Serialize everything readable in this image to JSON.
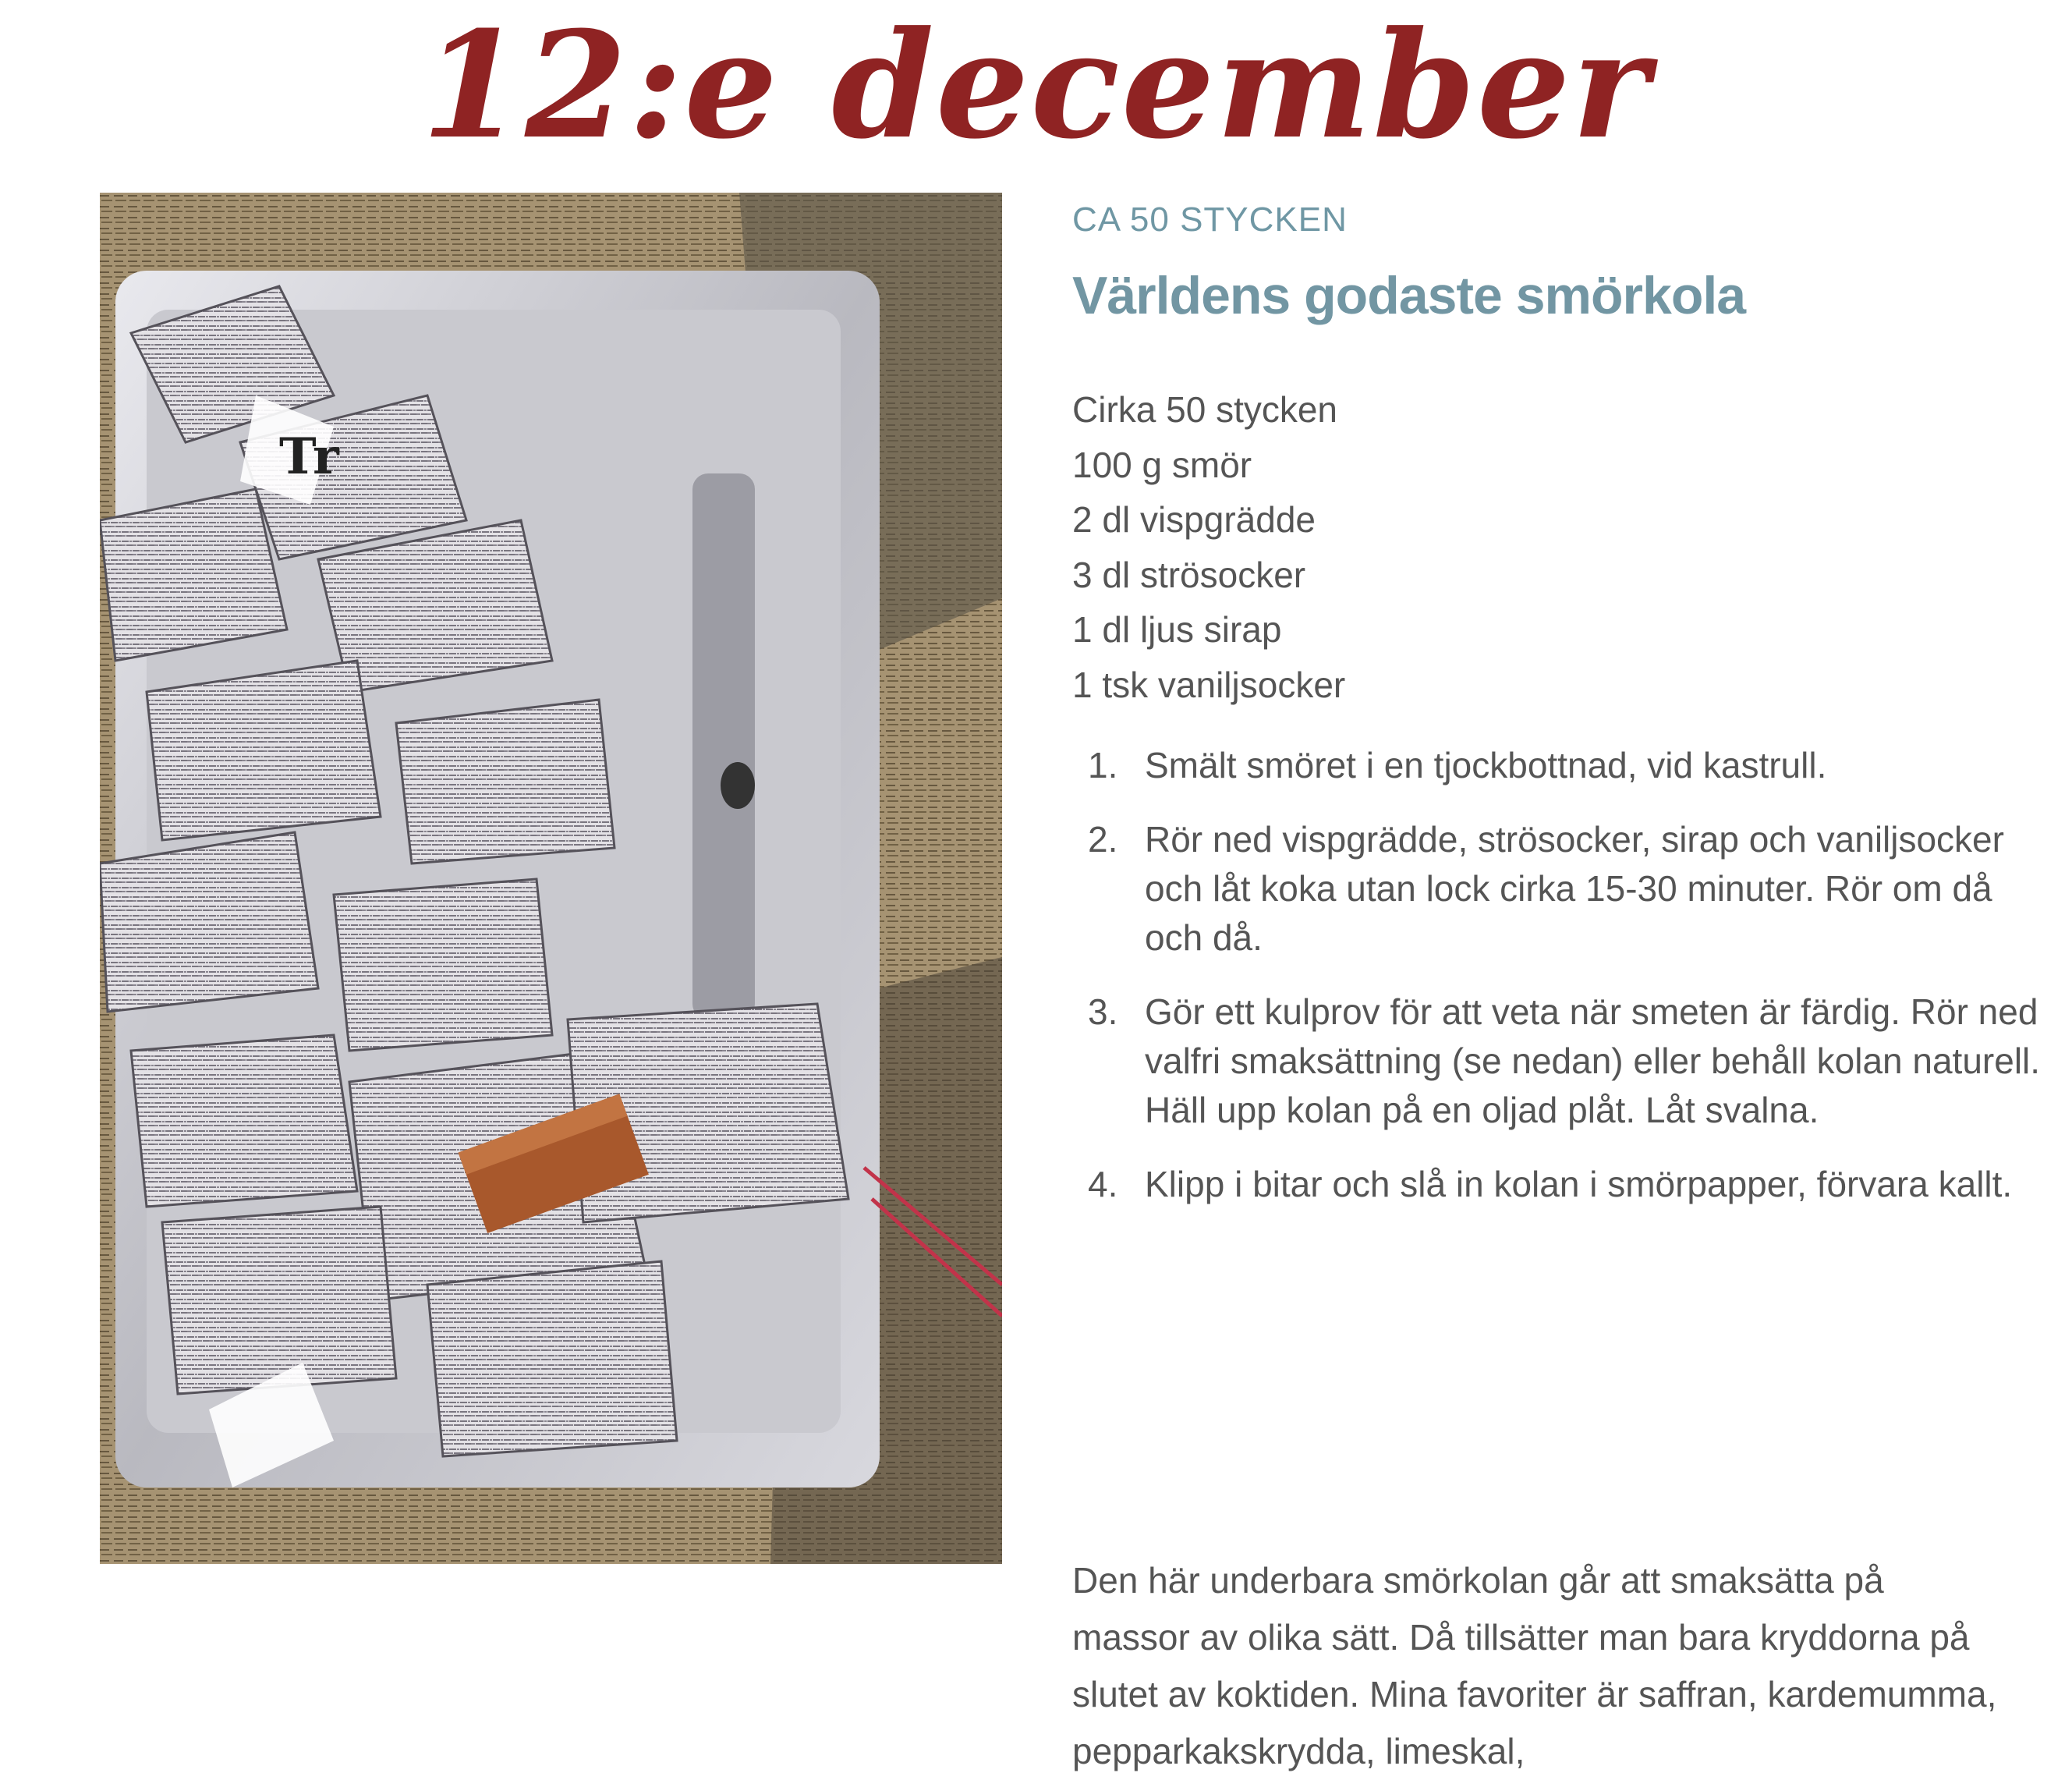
{
  "header": {
    "title": "12:e december"
  },
  "recipe": {
    "yield_label": "CA 50 STYCKEN",
    "title": "Världens godaste smörkola",
    "ingredients": [
      "Cirka 50 stycken",
      "100 g smör",
      "2 dl vispgrädde",
      "3 dl strösocker",
      "1 dl ljus sirap",
      "1 tsk vaniljsocker"
    ],
    "steps": [
      {
        "num": "1.",
        "text": "Smält smöret i en tjockbottnad, vid kastrull."
      },
      {
        "num": "2.",
        "text": "Rör ned vispgrädde, strösocker, sirap och vaniljsocker och låt koka utan lock cirka 15-30 minuter. Rör om då och då."
      },
      {
        "num": "3.",
        "text": "Gör ett kulprov för att veta när smeten är färdig. Rör ned valfri smaksättning (se nedan) eller behåll kolan naturell. Häll upp kolan på en oljad plåt. Låt svalna."
      },
      {
        "num": "4.",
        "text": "Klipp i bitar och slå in kolan i smörpapper, förvara kallt."
      }
    ],
    "outro": "Den här underbara smörkolan går att smaksätta på massor av olika sätt. Då tillsätter man bara kryddorna på slutet av koktiden. Mina favoriter är saffran, kardemumma, pepparkakskrydda, limeskal,"
  },
  "colors": {
    "title": "#8f2323",
    "recipe_accent": "#7296a3",
    "body_text": "#555555"
  }
}
